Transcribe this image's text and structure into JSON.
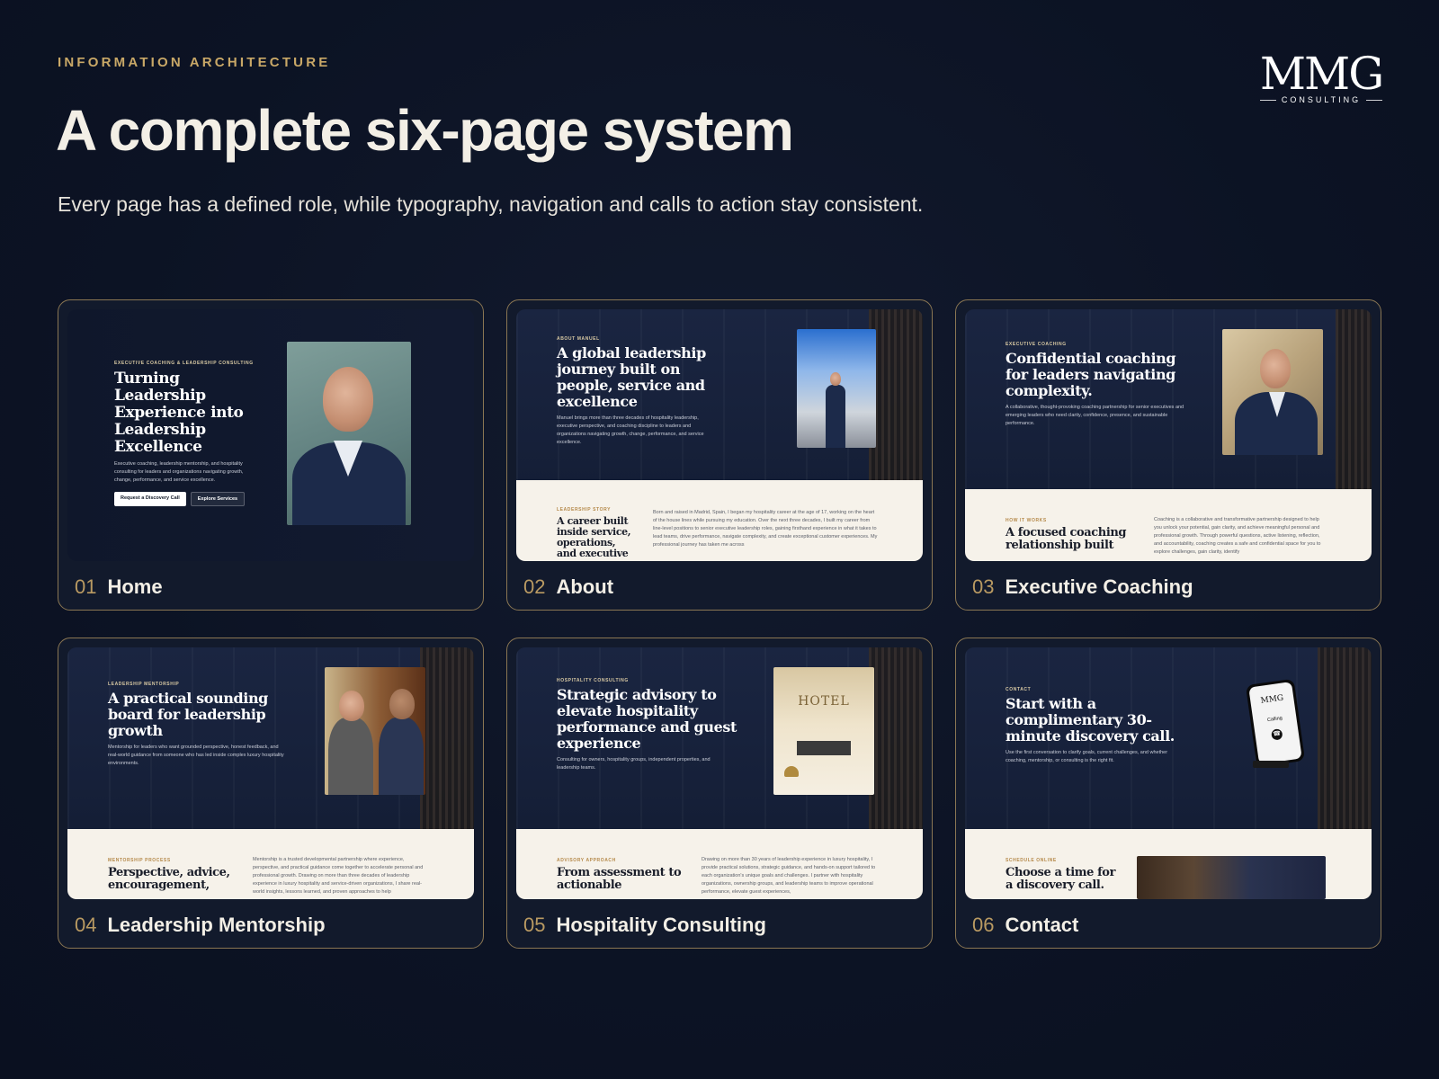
{
  "header": {
    "eyebrow": "INFORMATION ARCHITECTURE",
    "title": "A complete six-page system",
    "subtitle": "Every page has a defined role, while typography, navigation and calls to action stay consistent."
  },
  "logo": {
    "mark": "MMG",
    "sub": "CONSULTING"
  },
  "colors": {
    "background": "#0c1324",
    "accent_gold": "#c9a867",
    "card_border": "#8a7653",
    "cream": "#f6f2ea"
  },
  "cards": [
    {
      "number": "01",
      "label": "Home",
      "eyebrow": "EXECUTIVE COACHING & LEADERSHIP CONSULTING",
      "heading": "Turning Leadership Experience into Leadership Excellence",
      "body": "Executive coaching, leadership mentorship, and hospitality consulting for leaders and organizations navigating growth, change, performance, and service excellence.",
      "primary_button": "Request a Discovery Call",
      "secondary_button": "Explore Services"
    },
    {
      "number": "02",
      "label": "About",
      "eyebrow": "ABOUT MANUEL",
      "heading": "A global leadership journey built on people, service and excellence",
      "body": "Manuel brings more than three decades of hospitality leadership, executive perspective, and coaching discipline to leaders and organizations navigating growth, change, performance, and service excellence.",
      "section_eyebrow": "LEADERSHIP STORY",
      "section_heading": "A career built inside service, operations, and executive",
      "section_body": "Born and raised in Madrid, Spain, I began my hospitality career at the age of 17, working on the heart of the house lines while pursuing my education. Over the next three decades, I built my career from line-level positions to senior executive leadership roles, gaining firsthand experience in what it takes to lead teams, drive performance, navigate complexity, and create exceptional customer experiences. My professional journey has taken me across"
    },
    {
      "number": "03",
      "label": "Executive Coaching",
      "eyebrow": "EXECUTIVE COACHING",
      "heading": "Confidential coaching for leaders navigating complexity.",
      "body": "A collaborative, thought-provoking coaching partnership for senior executives and emerging leaders who need clarity, confidence, presence, and sustainable performance.",
      "section_eyebrow": "HOW IT WORKS",
      "section_heading": "A focused coaching relationship built",
      "section_body": "Coaching is a collaborative and transformative partnership designed to help you unlock your potential, gain clarity, and achieve meaningful personal and professional growth. Through powerful questions, active listening, reflection, and accountability, coaching creates a safe and confidential space for you to explore challenges, gain clarity, identify"
    },
    {
      "number": "04",
      "label": "Leadership Mentorship",
      "eyebrow": "LEADERSHIP MENTORSHIP",
      "heading": "A practical sounding board for leadership growth",
      "body": "Mentorship for leaders who want grounded perspective, honest feedback, and real-world guidance from someone who has led inside complex luxury hospitality environments.",
      "section_eyebrow": "MENTORSHIP PROCESS",
      "section_heading": "Perspective, advice, encouragement,",
      "section_body": "Mentorship is a trusted developmental partnership where experience, perspective, and practical guidance come together to accelerate personal and professional growth. Drawing on more than three decades of leadership experience in luxury hospitality and service-driven organizations, I share real-world insights, lessons learned, and proven approaches to help"
    },
    {
      "number": "05",
      "label": "Hospitality Consulting",
      "eyebrow": "HOSPITALITY CONSULTING",
      "heading": "Strategic advisory to elevate hospitality performance and guest experience",
      "body": "Consulting for owners, hospitality groups, independent properties, and leadership teams.",
      "photo_sign": "HOTEL",
      "section_eyebrow": "ADVISORY APPROACH",
      "section_heading": "From assessment to actionable",
      "section_body": "Drawing on more than 30 years of leadership experience in luxury hospitality, I provide practical solutions, strategic guidance, and hands-on support tailored to each organization's unique goals and challenges. I partner with hospitality organizations, ownership groups, and leadership teams to improve operational performance, elevate guest experiences,"
    },
    {
      "number": "06",
      "label": "Contact",
      "eyebrow": "CONTACT",
      "heading": "Start with a complimentary 30-minute discovery call.",
      "body": "Use the first conversation to clarify goals, current challenges, and whether coaching, mentorship, or consulting is the right fit.",
      "phone_logo": "MMG",
      "phone_status": "Calling",
      "section_eyebrow": "SCHEDULE ONLINE",
      "section_heading": "Choose a time for a discovery call."
    }
  ]
}
